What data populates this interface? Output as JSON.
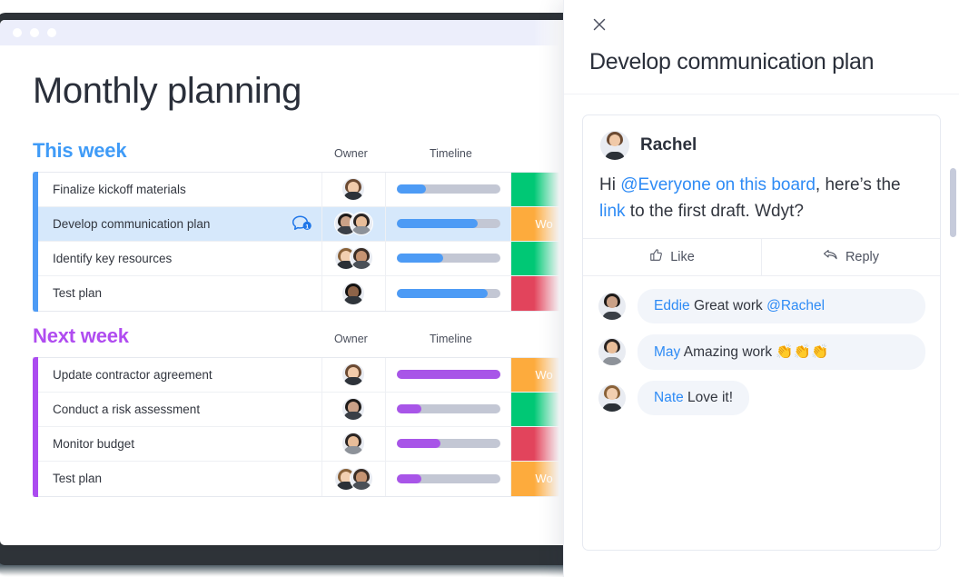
{
  "window": {
    "dots": 3
  },
  "board": {
    "title": "Monthly planning",
    "columns": {
      "task": "",
      "owner": "Owner",
      "timeline": "Timeline",
      "status": ""
    },
    "accent_blue": "#4d9bf5",
    "accent_violet": "#ab4bf0",
    "groups": [
      {
        "name": "This week",
        "color": "#3f9bf7",
        "accent": "#4d9bf5",
        "bar_color": "#4d9bf5",
        "owner_header": "Owner",
        "timeline_header": "Timeline",
        "rows": [
          {
            "task": "Finalize kickoff materials",
            "owners": 1,
            "progress": 28,
            "status": "",
            "status_color": "#00c875",
            "selected": false,
            "has_comment": false,
            "comment_count": ""
          },
          {
            "task": "Develop communication plan",
            "owners": 2,
            "progress": 78,
            "status": "Wo",
            "status_color": "#fdab3d",
            "selected": true,
            "has_comment": true,
            "comment_count": "1"
          },
          {
            "task": "Identify key resources",
            "owners": 2,
            "progress": 45,
            "status": "",
            "status_color": "#00c875",
            "selected": false,
            "has_comment": false,
            "comment_count": ""
          },
          {
            "task": "Test plan",
            "owners": 1,
            "progress": 88,
            "status": "",
            "status_color": "#e2445c",
            "selected": false,
            "has_comment": false,
            "comment_count": ""
          }
        ]
      },
      {
        "name": "Next week",
        "color": "#b04cf0",
        "accent": "#ab4bf0",
        "bar_color": "#a855e8",
        "owner_header": "Owner",
        "timeline_header": "Timeline",
        "rows": [
          {
            "task": "Update contractor agreement",
            "owners": 1,
            "progress": 100,
            "status": "Wo",
            "status_color": "#fdab3d",
            "selected": false,
            "has_comment": false,
            "comment_count": ""
          },
          {
            "task": "Conduct a risk assessment",
            "owners": 1,
            "progress": 24,
            "status": "",
            "status_color": "#00c875",
            "selected": false,
            "has_comment": false,
            "comment_count": ""
          },
          {
            "task": "Monitor budget",
            "owners": 1,
            "progress": 42,
            "status": "",
            "status_color": "#e2445c",
            "selected": false,
            "has_comment": false,
            "comment_count": ""
          },
          {
            "task": "Test plan",
            "owners": 2,
            "progress": 24,
            "status": "Wo",
            "status_color": "#fdab3d",
            "selected": false,
            "has_comment": false,
            "comment_count": ""
          }
        ]
      }
    ]
  },
  "panel": {
    "close_label": "×",
    "title": "Develop communication plan",
    "update": {
      "author": "Rachel",
      "text_parts": [
        {
          "text": "Hi ",
          "type": "plain"
        },
        {
          "text": "@Everyone on this board",
          "type": "mention"
        },
        {
          "text": ", here’s the ",
          "type": "plain"
        },
        {
          "text": "link",
          "type": "link"
        },
        {
          "text": " to the first draft. Wdyt?",
          "type": "plain"
        }
      ],
      "plain_text": "Hi @Everyone on this board, here’s the link to the first draft. Wdyt?",
      "like_label": "Like",
      "reply_label": "Reply",
      "like_icon": "thumbs-up-icon",
      "reply_icon": "reply-arrow-icon"
    },
    "comments": [
      {
        "author": "Eddie",
        "text": "Great work ",
        "mention": "@Rachel",
        "emoji": ""
      },
      {
        "author": "May",
        "text": "Amazing work ",
        "mention": "",
        "emoji": "👏👏👏"
      },
      {
        "author": "Nate",
        "text": "Love it!",
        "mention": "",
        "emoji": ""
      }
    ]
  },
  "colors": {
    "brand_blue": "#2e8bf5",
    "status_done": "#00c875",
    "status_working": "#fdab3d",
    "status_stuck": "#e2445c",
    "track_grey": "#c3c7d4",
    "selected_row": "#d6e8fb"
  }
}
